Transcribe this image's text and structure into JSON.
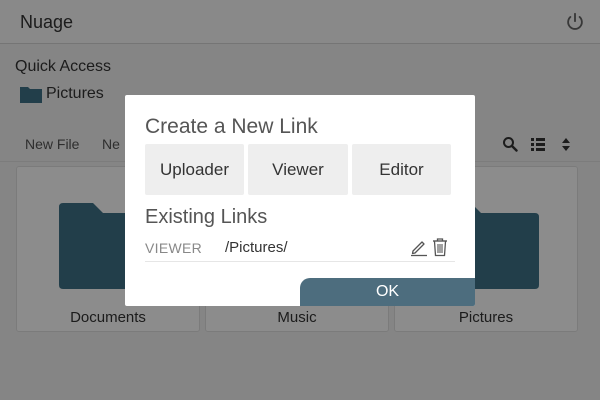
{
  "app": {
    "title": "Nuage",
    "power_icon": "power-icon"
  },
  "quick_access": {
    "label": "Quick Access",
    "items": [
      {
        "label": "Pictures",
        "icon": "folder-icon"
      }
    ]
  },
  "toolbar": {
    "new_file_label": "New File",
    "new_folder_label": "Ne",
    "icons": [
      "search-icon",
      "list-view-icon",
      "sort-icon"
    ]
  },
  "files": [
    {
      "name": "Documents",
      "icon": "folder-icon"
    },
    {
      "name": "Music",
      "icon": "folder-icon"
    },
    {
      "name": "Pictures",
      "icon": "folder-icon"
    }
  ],
  "modal": {
    "title": "Create a New Link",
    "buttons": {
      "uploader": "Uploader",
      "viewer": "Viewer",
      "editor": "Editor"
    },
    "existing_title": "Existing Links",
    "links": [
      {
        "type": "VIEWER",
        "path": "/Pictures/"
      }
    ],
    "ok_label": "OK"
  },
  "colors": {
    "accent": "#4d6d7e",
    "folder": "#3e7288",
    "overlay": "rgba(0,0,0,0.45)"
  }
}
